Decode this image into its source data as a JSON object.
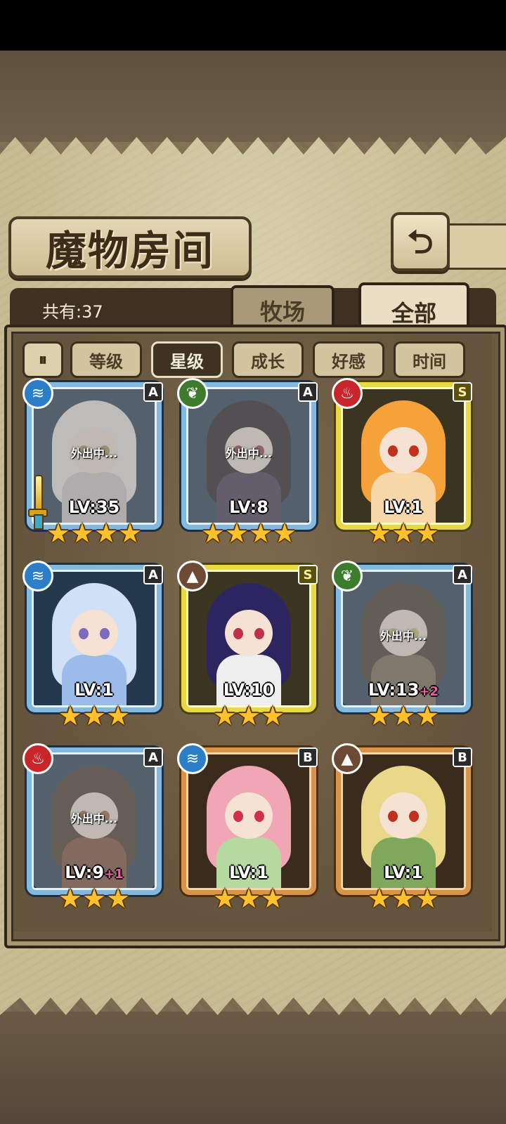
{
  "header": {
    "title": "魔物房间",
    "back_icon": "⮌",
    "count_label": "共有:37"
  },
  "tabs": [
    {
      "label": "牧场",
      "active": false
    },
    {
      "label": "全部",
      "active": true
    }
  ],
  "sort": {
    "toggle_icon": "⏸",
    "buttons": [
      {
        "label": "等级",
        "active": false
      },
      {
        "label": "星级",
        "active": true
      },
      {
        "label": "成长",
        "active": false
      },
      {
        "label": "好感",
        "active": false
      },
      {
        "label": "时间",
        "active": false
      }
    ]
  },
  "monsters": [
    {
      "level": "LV:35",
      "plus": "",
      "rank": "A",
      "element": "water",
      "frame": "blue",
      "stars": "★★★★",
      "status": "外出中...",
      "equipped_weapon": true
    },
    {
      "level": "LV:8",
      "plus": "",
      "rank": "A",
      "element": "wood",
      "frame": "blue",
      "stars": "★★★★",
      "status": "外出中..."
    },
    {
      "level": "LV:1",
      "plus": "",
      "rank": "S",
      "element": "fire",
      "frame": "yellow",
      "stars": "★★★",
      "status": ""
    },
    {
      "level": "LV:1",
      "plus": "",
      "rank": "A",
      "element": "water",
      "frame": "blue",
      "stars": "★★★",
      "status": ""
    },
    {
      "level": "LV:10",
      "plus": "",
      "rank": "S",
      "element": "earth",
      "frame": "yellow",
      "stars": "★★★",
      "status": ""
    },
    {
      "level": "LV:13",
      "plus": "+2",
      "rank": "A",
      "element": "wood",
      "frame": "blue",
      "stars": "★★★",
      "status": "外出中..."
    },
    {
      "level": "LV:9",
      "plus": "+1",
      "rank": "A",
      "element": "fire",
      "frame": "blue",
      "stars": "★★★",
      "status": "外出中..."
    },
    {
      "level": "LV:1",
      "plus": "",
      "rank": "B",
      "element": "water",
      "frame": "orange",
      "stars": "★★★",
      "status": ""
    },
    {
      "level": "LV:1",
      "plus": "",
      "rank": "B",
      "element": "earth",
      "frame": "orange",
      "stars": "★★★",
      "status": ""
    }
  ],
  "element_icons": {
    "water": "≋",
    "wood": "❦",
    "fire": "♨",
    "earth": "▲"
  },
  "colors": {
    "accent": "#e9dfc5",
    "plus": "#f05aa8",
    "star": "#ffc22a"
  }
}
